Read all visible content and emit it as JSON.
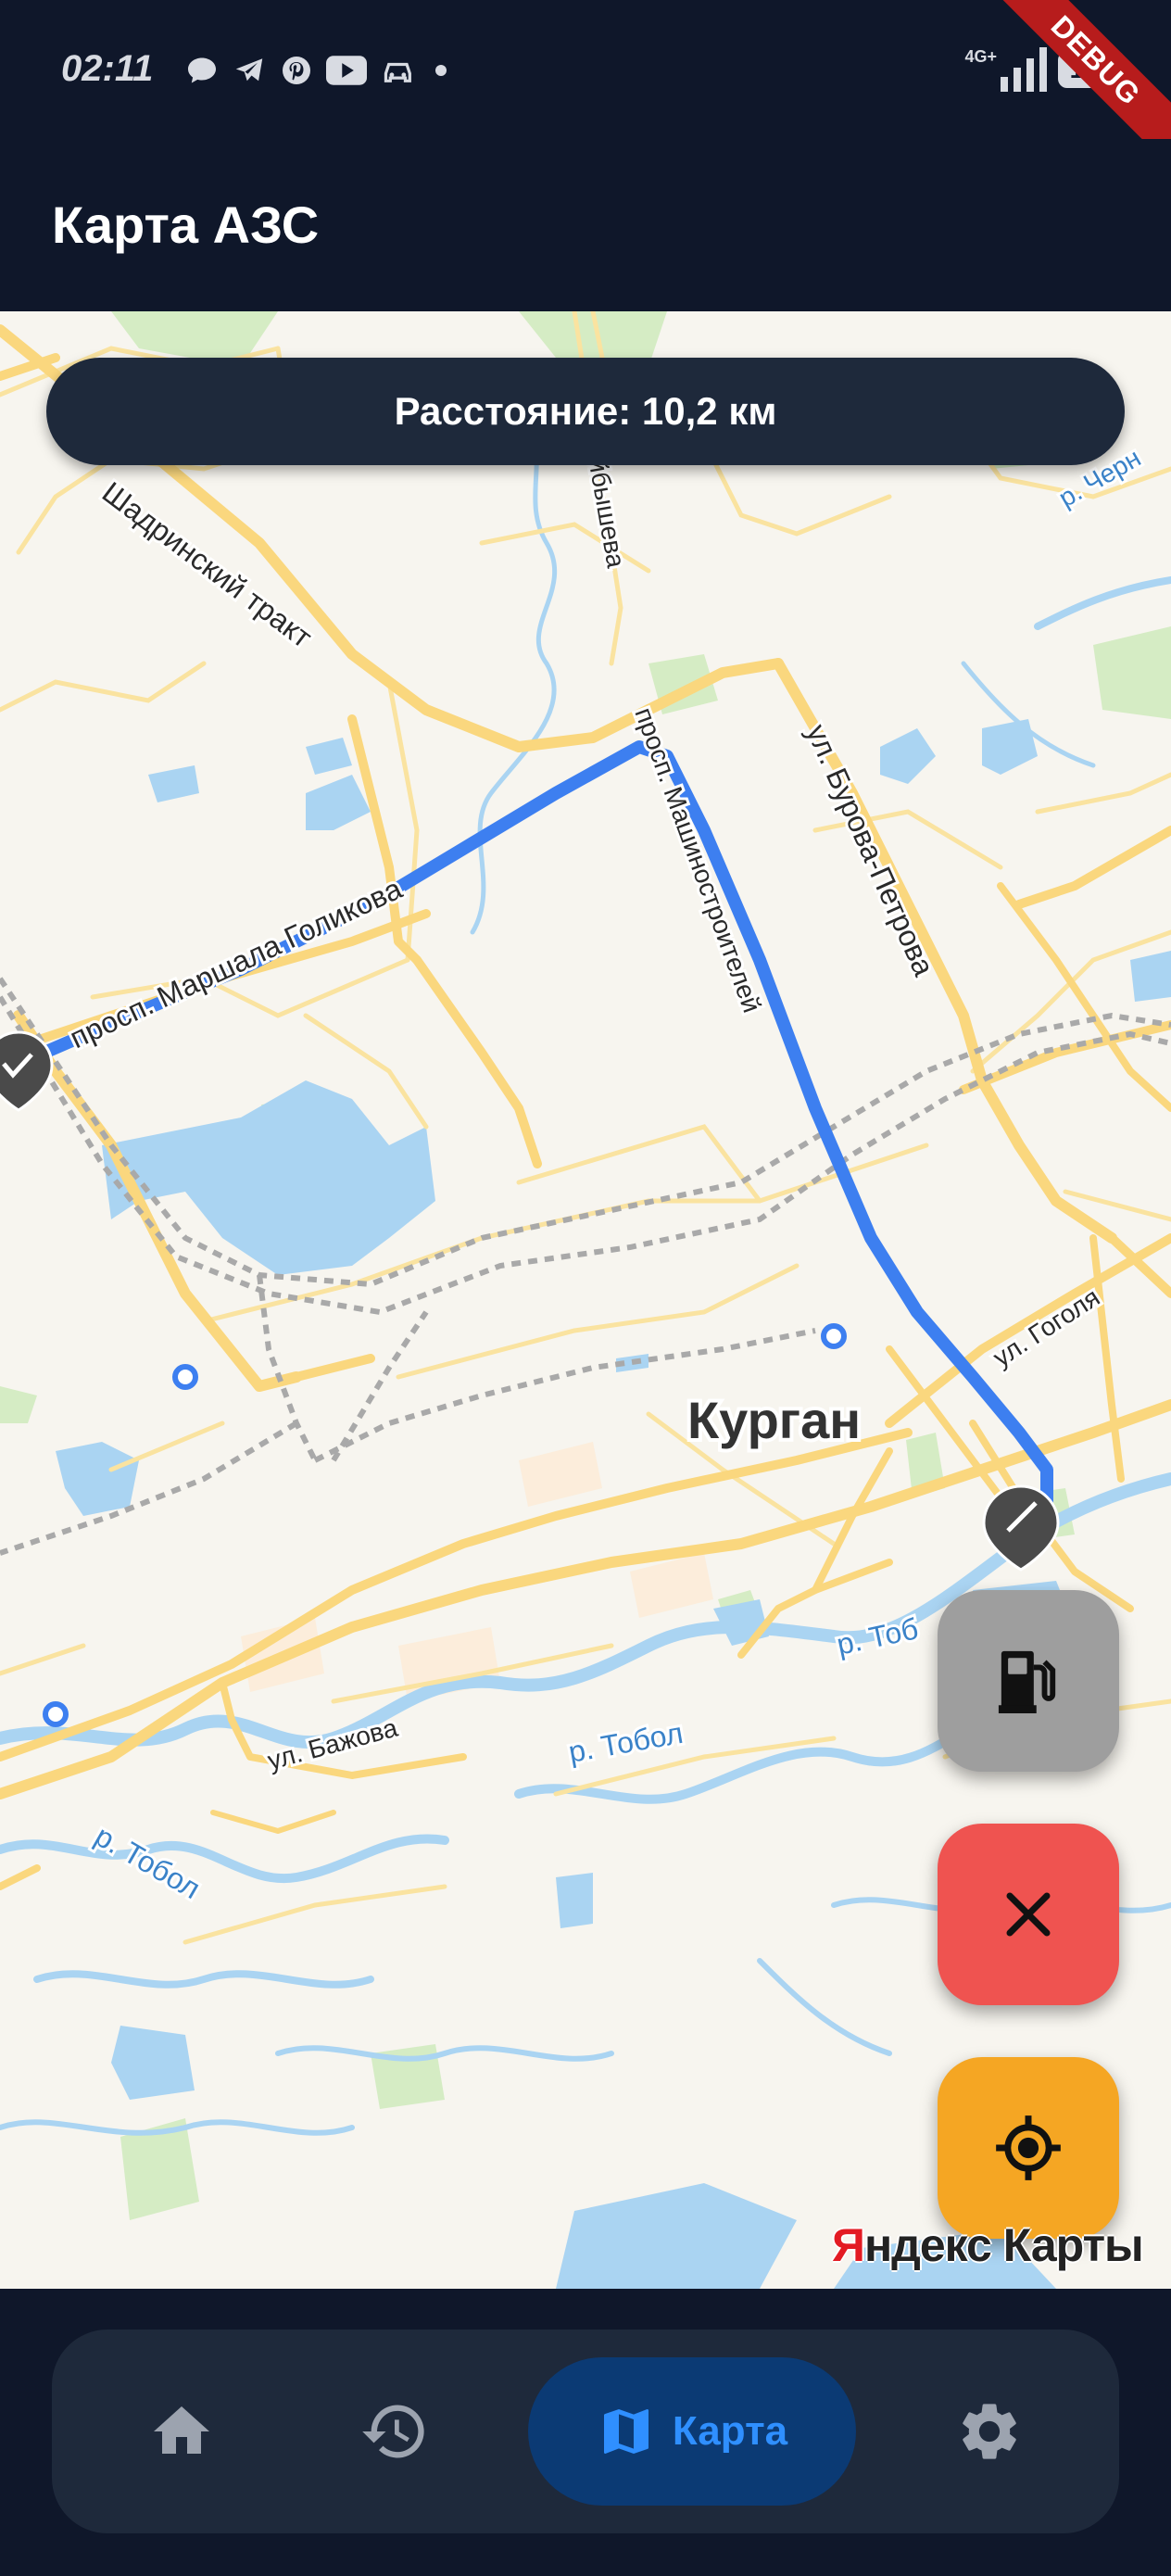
{
  "status_bar": {
    "time": "02:11",
    "icons": [
      "chat-icon",
      "telegram-icon",
      "pinterest-icon",
      "youtube-icon",
      "car-icon",
      "dot-icon"
    ],
    "network": "4G+",
    "battery": "100",
    "debug_banner": "DEBUG"
  },
  "app_bar": {
    "title": "Карта АЗС"
  },
  "map": {
    "distance_label": "Расстояние: 10,2 км",
    "city_label": "Курган",
    "street_labels": {
      "shadrinsky": "Шадринский тракт",
      "kuibysheva": "Куйбышева",
      "mashinostroiteley": "просп. Машиностроителей",
      "burova_petrova": "ул. Бурова-Петрова",
      "golikova": "просп. Маршала Голикова",
      "gogolya": "ул. Гоголя",
      "bazhova": "ул. Бажова",
      "tobol_1": "р. Тобол",
      "tobol_2": "р. Тобол",
      "tobol_3": "р. Тоб",
      "river_ne": "р. Черн"
    },
    "attribution": {
      "first_letter": "Я",
      "rest": "ндекс Карты"
    },
    "route_color": "#3d7ff0"
  },
  "fabs": {
    "fuel": {
      "icon": "fuel-pump-icon",
      "color": "#9e9e9e"
    },
    "cancel": {
      "icon": "close-icon",
      "color": "#ef5350"
    },
    "locate": {
      "icon": "my-location-icon",
      "color": "#f5a623"
    }
  },
  "bottom_nav": {
    "items": [
      {
        "icon": "home-icon",
        "label": ""
      },
      {
        "icon": "history-icon",
        "label": ""
      },
      {
        "icon": "map-icon",
        "label": "Карта",
        "selected": true
      },
      {
        "icon": "settings-icon",
        "label": ""
      }
    ]
  }
}
